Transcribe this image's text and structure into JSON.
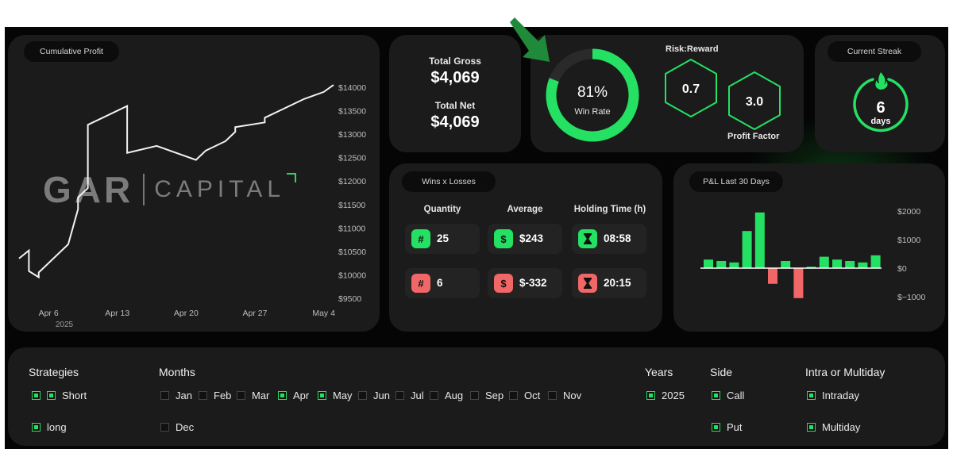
{
  "colors": {
    "accent": "#24e063",
    "negative": "#f16666",
    "card": "#1b1b1b",
    "background": "#050505"
  },
  "cumulative_profit": {
    "title": "Cumulative Profit",
    "watermark": {
      "left": "GAR",
      "right": "CAPITAL"
    },
    "y_ticks": [
      "$14000",
      "$13500",
      "$13000",
      "$12500",
      "$12000",
      "$11500",
      "$11000",
      "$10500",
      "$10000",
      "$9500"
    ],
    "x_ticks": [
      "Apr 6",
      "Apr 13",
      "Apr 20",
      "Apr 27",
      "May 4"
    ],
    "x_year": "2025"
  },
  "chart_data": [
    {
      "type": "line",
      "title": "Cumulative Profit",
      "x": [
        "Apr 3",
        "Apr 4",
        "Apr 4",
        "Apr 5",
        "Apr 5",
        "Apr 8",
        "Apr 9",
        "Apr 9",
        "Apr 10",
        "Apr 10",
        "Apr 14",
        "Apr 14",
        "Apr 17",
        "Apr 21",
        "Apr 22",
        "Apr 24",
        "Apr 25",
        "Apr 25",
        "Apr 28",
        "Apr 28",
        "Apr 30",
        "May 2",
        "May 4",
        "May 5"
      ],
      "y": [
        10350,
        10520,
        10080,
        9950,
        10050,
        10650,
        11400,
        11650,
        11850,
        13200,
        13600,
        12600,
        12750,
        12450,
        12650,
        12850,
        13050,
        13150,
        13250,
        13350,
        13550,
        13750,
        13900,
        14050
      ],
      "ylim": [
        9500,
        14000
      ],
      "ylabel": "",
      "xlabel": ""
    },
    {
      "type": "bar",
      "title": "P&L Last 30 Days",
      "values": [
        300,
        250,
        200,
        1300,
        1950,
        -550,
        250,
        -1050,
        50,
        400,
        300,
        250,
        200,
        450
      ],
      "y_ticks": [
        "$2000",
        "$1000",
        "$0",
        "$−1000"
      ],
      "ylim": [
        -1000,
        2000
      ]
    },
    {
      "type": "pie",
      "title": "Win Rate",
      "values": [
        81,
        19
      ]
    }
  ],
  "gross": {
    "gross_label": "Total Gross",
    "gross_value": "$4,069",
    "net_label": "Total Net",
    "net_value": "$4,069"
  },
  "win_rate": {
    "value": "81%",
    "label": "Win Rate"
  },
  "risk_reward": {
    "title": "Risk:Reward",
    "value": "0.7"
  },
  "profit_factor": {
    "title": "Profit Factor",
    "value": "3.0"
  },
  "streak": {
    "title": "Current Streak",
    "value": "6",
    "unit": "days",
    "icon": "flame-icon"
  },
  "wins_losses": {
    "title": "Wins x Losses",
    "columns": [
      "Quantity",
      "Average",
      "Holding Time (h)"
    ],
    "wins": [
      {
        "icon": "#",
        "value": "25"
      },
      {
        "icon": "$",
        "value": "$243"
      },
      {
        "icon": "hourglass-icon",
        "value": "08:58"
      }
    ],
    "losses": [
      {
        "icon": "#",
        "value": "6"
      },
      {
        "icon": "$",
        "value": "$-332"
      },
      {
        "icon": "hourglass-icon",
        "value": "20:15"
      }
    ]
  },
  "pnl": {
    "title": "P&L Last 30 Days",
    "y_ticks": [
      "$2000",
      "$1000",
      "$0",
      "$−1000"
    ]
  },
  "filters": {
    "strategies": {
      "title": "Strategies",
      "options": [
        {
          "label": "Short",
          "checked": true
        },
        {
          "label": "long",
          "checked": true
        }
      ]
    },
    "months": {
      "title": "Months",
      "options": [
        {
          "label": "Jan",
          "checked": false
        },
        {
          "label": "Feb",
          "checked": false
        },
        {
          "label": "Mar",
          "checked": false
        },
        {
          "label": "Apr",
          "checked": true
        },
        {
          "label": "May",
          "checked": true
        },
        {
          "label": "Jun",
          "checked": false
        },
        {
          "label": "Jul",
          "checked": false
        },
        {
          "label": "Aug",
          "checked": false
        },
        {
          "label": "Sep",
          "checked": false
        },
        {
          "label": "Oct",
          "checked": false
        },
        {
          "label": "Nov",
          "checked": false
        },
        {
          "label": "Dec",
          "checked": false
        }
      ]
    },
    "years": {
      "title": "Years",
      "options": [
        {
          "label": "2025",
          "checked": true
        }
      ]
    },
    "side": {
      "title": "Side",
      "options": [
        {
          "label": "Call",
          "checked": true
        },
        {
          "label": "Put",
          "checked": true
        }
      ]
    },
    "intra": {
      "title": "Intra or Multiday",
      "options": [
        {
          "label": "Intraday",
          "checked": true
        },
        {
          "label": "Multiday",
          "checked": true
        }
      ]
    }
  }
}
